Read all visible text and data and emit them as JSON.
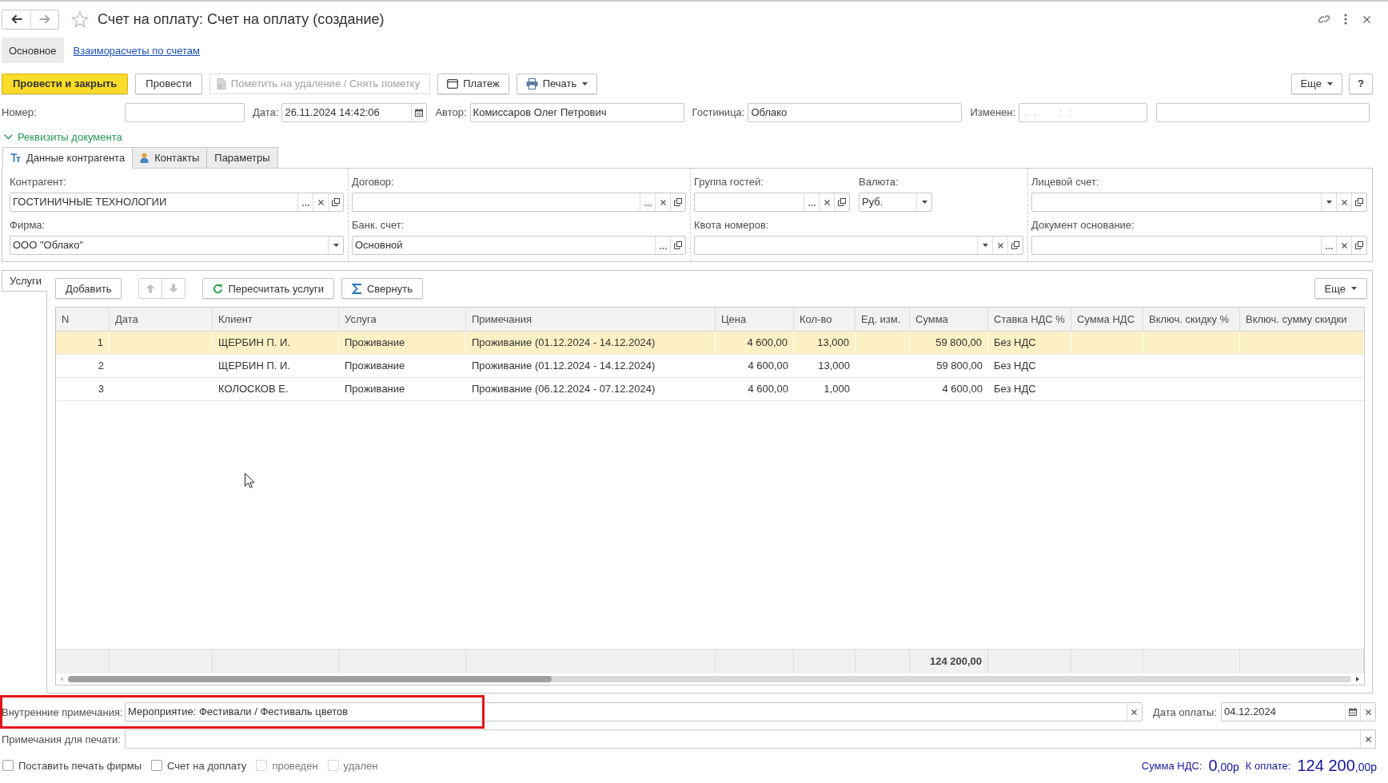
{
  "window": {
    "title": "Счет на оплату: Счет на оплату (создание)",
    "favorite": false
  },
  "nav_buttons": [
    {
      "kind": "back",
      "disabled": false
    },
    {
      "kind": "forward",
      "disabled": true
    }
  ],
  "sections": [
    {
      "label": "Основное",
      "selected": true
    },
    {
      "label": "Взаиморасчеты по счетам",
      "selected": false
    }
  ],
  "command_bar": {
    "buttons": [
      {
        "label": "Провести и закрыть",
        "kind": "primary",
        "disabled": false,
        "menu": false
      },
      {
        "label": "Провести",
        "kind": "plain",
        "disabled": false,
        "menu": false
      },
      {
        "label": "Пометить на удаление / Снять пометку",
        "kind": "mark",
        "disabled": true,
        "menu": false
      },
      {
        "label": "Платеж",
        "kind": "payment",
        "disabled": false,
        "menu": false
      },
      {
        "label": "Печать",
        "kind": "print",
        "disabled": false,
        "menu": true
      }
    ],
    "more": {
      "label": "Еще",
      "menu": true
    },
    "help": {
      "label": "?"
    }
  },
  "header_fields": [
    {
      "label": "Номер:"
    },
    {
      "label": "Дата:",
      "value": "26.11.2024 14:42:06",
      "actions": [
        {
          "kind": "calendar"
        }
      ]
    },
    {
      "label": "Автор:",
      "value": "Комиссаров Олег Петрович"
    },
    {
      "label": "Гостиница:",
      "value": "Облако"
    },
    {
      "label": "Изменен:",
      "placeholder": " .  .        :  :"
    }
  ],
  "details": {
    "title": "Реквизиты документа",
    "expanded": true,
    "tabs": [
      {
        "label": "Данные контрагента",
        "kind": "typed",
        "selected": true
      },
      {
        "label": "Контакты",
        "kind": "person",
        "selected": false
      },
      {
        "label": "Параметры",
        "kind": "plain",
        "selected": false
      }
    ],
    "columns": [
      {
        "rows": [
          {
            "fields": [
              {
                "label": "Контрагент:",
                "value": "ГОСТИНИЧНЫЕ ТЕХНОЛОГИИ",
                "actions": [
                  {
                    "kind": "select"
                  },
                  {
                    "kind": "clear"
                  },
                  {
                    "kind": "open"
                  }
                ]
              }
            ]
          },
          {
            "fields": [
              {
                "label": "Фирма:",
                "value": "ООО \"Облако\"",
                "actions": [
                  {
                    "kind": "dropdown"
                  }
                ]
              }
            ]
          }
        ]
      },
      {
        "rows": [
          {
            "fields": [
              {
                "label": "Договор:",
                "actions": [
                  {
                    "kind": "select"
                  },
                  {
                    "kind": "clear"
                  },
                  {
                    "kind": "open"
                  }
                ]
              }
            ]
          },
          {
            "fields": [
              {
                "label": "Банк. счет:",
                "value": "Основной",
                "actions": [
                  {
                    "kind": "select"
                  },
                  {
                    "kind": "open"
                  }
                ]
              }
            ]
          }
        ]
      },
      {
        "rows": [
          {
            "fields": [
              {
                "label": "Группа гостей:",
                "actions": [
                  {
                    "kind": "select"
                  },
                  {
                    "kind": "clear"
                  },
                  {
                    "kind": "open"
                  }
                ]
              },
              {
                "label": "Валюта:",
                "value": "Руб.",
                "actions": [
                  {
                    "kind": "dropdown"
                  }
                ]
              }
            ]
          },
          {
            "fields": [
              {
                "label": "Квота номеров:",
                "actions": [
                  {
                    "kind": "dropdown"
                  },
                  {
                    "kind": "clear"
                  },
                  {
                    "kind": "open"
                  }
                ]
              }
            ]
          }
        ]
      },
      {
        "rows": [
          {
            "fields": [
              {
                "label": "Лицевой счет:",
                "actions": [
                  {
                    "kind": "dropdown"
                  },
                  {
                    "kind": "clear"
                  },
                  {
                    "kind": "open"
                  }
                ]
              }
            ]
          },
          {
            "fields": [
              {
                "label": "Документ основание:",
                "actions": [
                  {
                    "kind": "select"
                  },
                  {
                    "kind": "clear"
                  },
                  {
                    "kind": "open"
                  }
                ]
              }
            ]
          }
        ]
      }
    ]
  },
  "services": {
    "tab": {
      "label": "Услуги",
      "selected": true
    },
    "toolbar": [
      {
        "kind": "plain",
        "label": "Добавить",
        "disabled": false
      },
      {
        "kind": "move-up",
        "disabled": true
      },
      {
        "kind": "move-down",
        "disabled": true
      },
      {
        "kind": "recalc",
        "label": "Пересчитать услуги",
        "disabled": false
      },
      {
        "kind": "collapse",
        "label": "Свернуть",
        "disabled": false
      }
    ],
    "more": {
      "label": "Еще",
      "menu": true
    },
    "table": {
      "columns": [
        {
          "label": "N"
        },
        {
          "label": "Дата"
        },
        {
          "label": "Клиент"
        },
        {
          "label": "Услуга"
        },
        {
          "label": "Примечания"
        },
        {
          "label": "Цена"
        },
        {
          "label": "Кол-во"
        },
        {
          "label": "Ед. изм."
        },
        {
          "label": "Сумма",
          "total": "124 200,00"
        },
        {
          "label": "Ставка НДС %"
        },
        {
          "label": "Сумма НДС"
        },
        {
          "label": "Включ. скидку %"
        },
        {
          "label": "Включ. сумму скидки"
        }
      ],
      "rows": [
        {
          "n": "1",
          "client": "ЩЕРБИН П. И.",
          "service": "Проживание",
          "note": "Проживание (01.12.2024 - 14.12.2024)",
          "price": "4 600,00",
          "qty": "13,000",
          "sum": "59 800,00",
          "vat_rate": "Без НДС",
          "selected": true
        },
        {
          "n": "2",
          "client": "ЩЕРБИН П. И.",
          "service": "Проживание",
          "note": "Проживание (01.12.2024 - 14.12.2024)",
          "price": "4 600,00",
          "qty": "13,000",
          "sum": "59 800,00",
          "vat_rate": "Без НДС",
          "selected": false
        },
        {
          "n": "3",
          "client": "КОЛОСКОВ Е.",
          "service": "Проживание",
          "note": "Проживание (06.12.2024 - 07.12.2024)",
          "price": "4 600,00",
          "qty": "1,000",
          "sum": "4 600,00",
          "vat_rate": "Без НДС",
          "selected": false
        }
      ]
    }
  },
  "bottom_rows": [
    {
      "fields": [
        {
          "label": "Внутренние примечания:",
          "value": "Мероприятие: Фестивали / Фестиваль цветов",
          "actions": [
            {
              "kind": "clear"
            }
          ],
          "highlighted": true
        },
        {
          "label": "Дата оплаты:",
          "value": "04.12.2024",
          "actions": [
            {
              "kind": "calendar"
            },
            {
              "kind": "clear"
            }
          ]
        }
      ]
    },
    {
      "fields": [
        {
          "label": "Примечания для печати:",
          "actions": [
            {
              "kind": "clear"
            }
          ]
        }
      ]
    }
  ],
  "options": [
    {
      "label": "Поставить печать фирмы",
      "checked": false,
      "disabled": false
    },
    {
      "label": "Счет на доплату",
      "checked": false,
      "disabled": false
    },
    {
      "label": "проведен",
      "checked": false,
      "disabled": true
    },
    {
      "label": "удален",
      "checked": false,
      "disabled": true
    }
  ],
  "totals": [
    {
      "label": "Сумма НДС:",
      "value": "0",
      "fraction": ",00р"
    },
    {
      "label": "К оплате:",
      "value": "124 200",
      "fraction": ",00р"
    }
  ]
}
